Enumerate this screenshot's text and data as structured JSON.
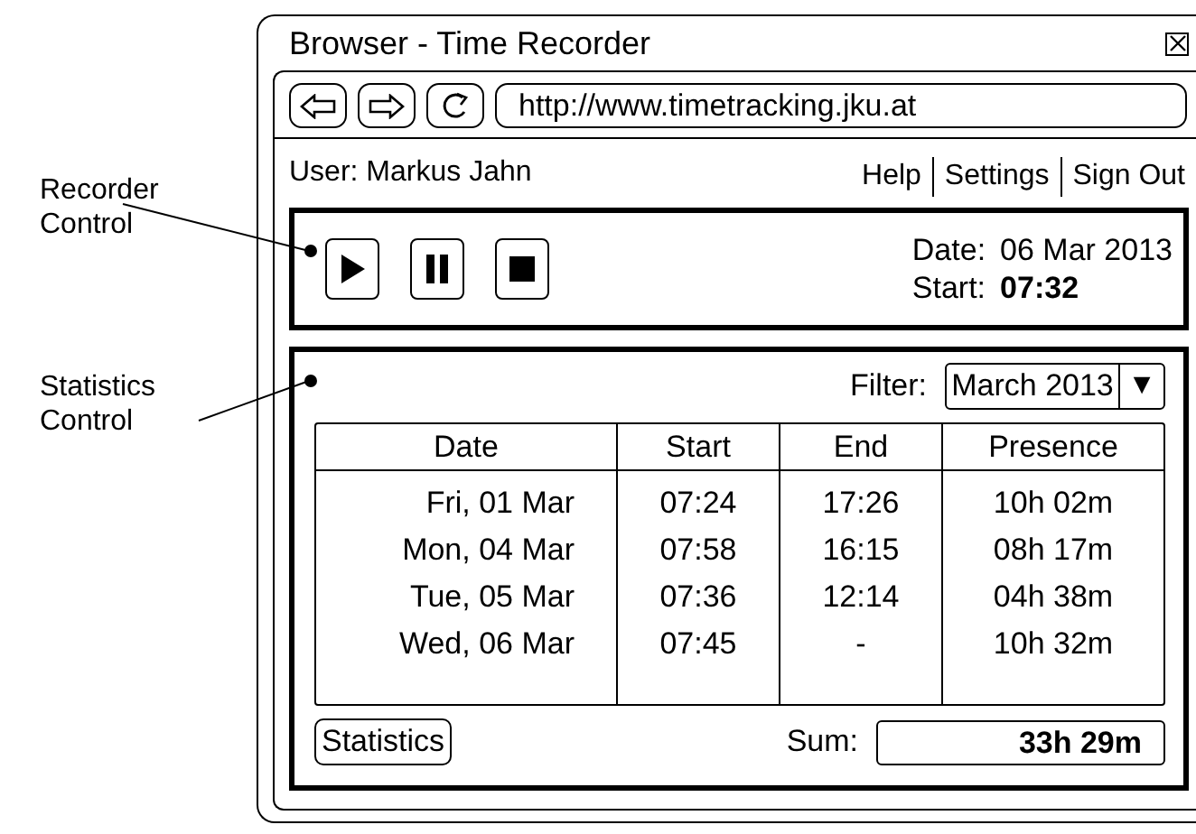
{
  "callouts": [
    {
      "label": "Recorder Control"
    },
    {
      "label": "Statistics Control"
    }
  ],
  "window": {
    "title": "Browser - Time Recorder"
  },
  "address_bar": {
    "url": "http://www.timetracking.jku.at"
  },
  "header": {
    "user": "User: Markus Jahn",
    "links": [
      "Help",
      "Settings",
      "Sign Out"
    ]
  },
  "recorder": {
    "buttons": [
      {
        "kind": "play"
      },
      {
        "kind": "pause"
      },
      {
        "kind": "stop"
      }
    ],
    "date_label": "Date:",
    "date": "06 Mar 2013",
    "start_label": "Start:",
    "start": "07:32"
  },
  "statistics": {
    "filter_label": "Filter:",
    "filter": "March 2013",
    "dropdown_glyph": "▼",
    "table": {
      "columns": [
        "Date",
        "Start",
        "End",
        "Presence"
      ],
      "rows": [
        [
          "Fri, 01 Mar",
          "07:24",
          "17:26",
          "10h 02m"
        ],
        [
          "Mon, 04 Mar",
          "07:58",
          "16:15",
          "08h 17m"
        ],
        [
          "Tue, 05 Mar",
          "07:36",
          "12:14",
          "04h 38m"
        ],
        [
          "Wed, 06 Mar",
          "07:45",
          "-",
          "10h 32m"
        ]
      ]
    },
    "button": "Statistics",
    "sum_label": "Sum:",
    "sum": "33h 29m"
  }
}
